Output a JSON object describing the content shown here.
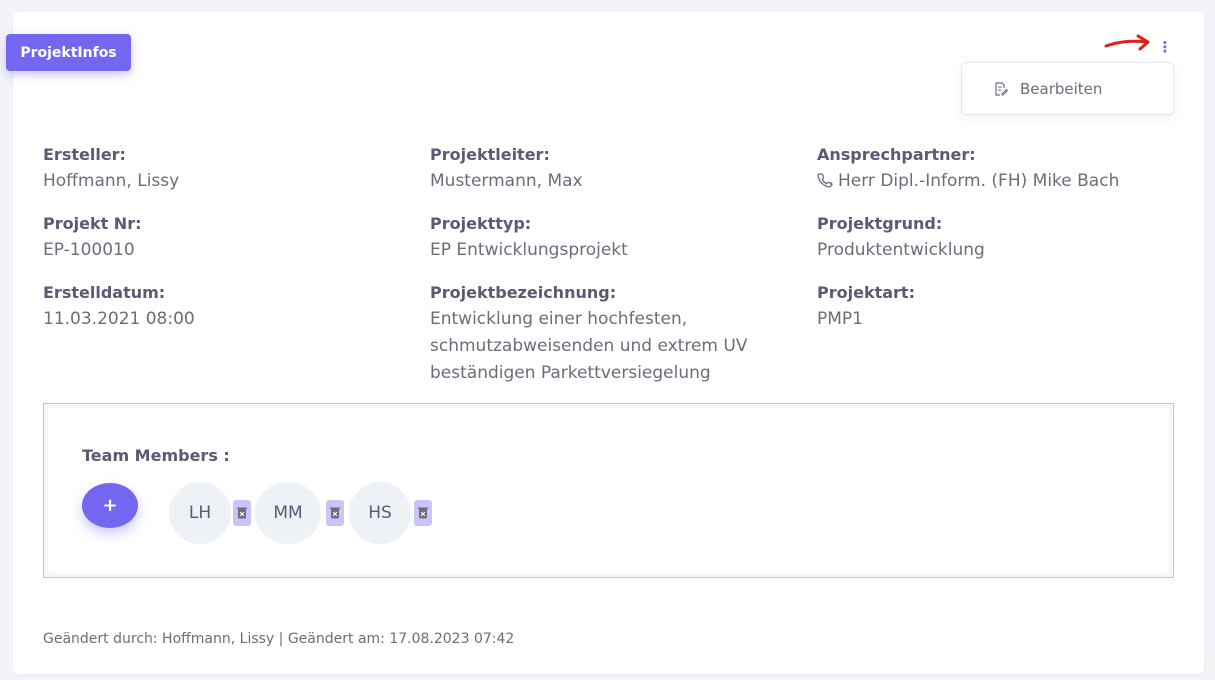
{
  "card": {
    "tag": "ProjektInfos"
  },
  "menu": {
    "dots": "⋮",
    "edit_label": "Bearbeiten"
  },
  "fields": {
    "ersteller": {
      "label": "Ersteller:",
      "value": "Hoffmann, Lissy"
    },
    "projektleiter": {
      "label": "Projektleiter:",
      "value": "Mustermann, Max"
    },
    "ansprechpartner": {
      "label": "Ansprechpartner:",
      "value": "Herr Dipl.-Inform. (FH) Mike Bach"
    },
    "projekt_nr": {
      "label": "Projekt Nr:",
      "value": "EP-100010"
    },
    "projekttyp": {
      "label": "Projekttyp:",
      "value": "EP Entwicklungsprojekt"
    },
    "projektgrund": {
      "label": "Projektgrund:",
      "value": "Produktentwicklung"
    },
    "erstelldatum": {
      "label": "Erstelldatum:",
      "value": "11.03.2021 08:00"
    },
    "projektbezeichnung": {
      "label": "Projektbezeichnung:",
      "value": "Entwicklung einer hochfesten, schmutzabweisenden und extrem UV beständigen Parkettversiegelung"
    },
    "projektart": {
      "label": "Projektart:",
      "value": "PMP1"
    }
  },
  "team": {
    "title": "Team Members :",
    "add_label": "+",
    "members": [
      {
        "initials": "LH"
      },
      {
        "initials": "MM"
      },
      {
        "initials": "HS"
      }
    ]
  },
  "footer": {
    "text": "Geändert durch: Hoffmann, Lissy | Geändert am: 17.08.2023 07:42"
  },
  "colors": {
    "accent": "#7367f0",
    "delete_bg": "#c9c5fb",
    "annotation": "#e0201b"
  },
  "icons": {
    "edit": "edit-icon",
    "phone": "phone-icon",
    "delete": "trash-icon",
    "menu": "more-vertical-icon"
  }
}
